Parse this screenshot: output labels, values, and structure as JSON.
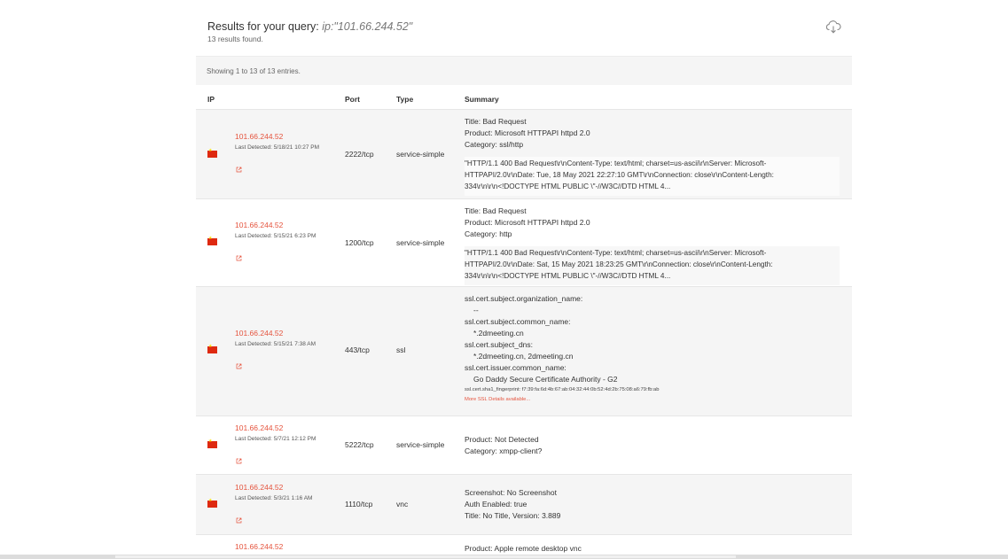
{
  "header": {
    "title_prefix": "Results for your query: ",
    "query": "ip:\"101.66.244.52\"",
    "results_found": "13 results found."
  },
  "showing": "Showing 1 to 13 of 13 entries.",
  "columns": {
    "ip": "IP",
    "port": "Port",
    "type": "Type",
    "summary": "Summary"
  },
  "icons": {
    "download": "cloud-download-icon",
    "flag": "china-flag-icon",
    "external": "external-link-icon"
  },
  "accent_color": "#e5533d",
  "rows": [
    {
      "ip": "101.66.244.52",
      "detected": "Last Detected: 5/18/21 10:27 PM",
      "port": "2222/tcp",
      "type": "service-simple",
      "summary": [
        "Title: Bad Request",
        "Product: Microsoft HTTPAPI httpd 2.0",
        "Category: ssl/http"
      ],
      "banner": "\"HTTP/1.1 400 Bad Request\\r\\nContent-Type: text/html; charset=us-ascii\\r\\nServer: Microsoft-HTTPAPI/2.0\\r\\nDate: Tue, 18 May 2021 22:27:10 GMT\\r\\nConnection: close\\r\\nContent-Length: 334\\r\\n\\r\\n<!DOCTYPE HTML PUBLIC \\\"-//W3C//DTD HTML 4..."
    },
    {
      "ip": "101.66.244.52",
      "detected": "Last Detected: 5/15/21 6:23 PM",
      "port": "1200/tcp",
      "type": "service-simple",
      "summary": [
        "Title: Bad Request",
        "Product: Microsoft HTTPAPI httpd 2.0",
        "Category: http"
      ],
      "banner": "\"HTTP/1.1 400 Bad Request\\r\\nContent-Type: text/html; charset=us-ascii\\r\\nServer: Microsoft-HTTPAPI/2.0\\r\\nDate: Sat, 15 May 2021 18:23:25 GMT\\r\\nConnection: close\\r\\nContent-Length: 334\\r\\n\\r\\n<!DOCTYPE HTML PUBLIC \\\"-//W3C//DTD HTML 4..."
    },
    {
      "ip": "101.66.244.52",
      "detected": "Last Detected: 5/15/21 7:38 AM",
      "port": "443/tcp",
      "type": "ssl",
      "ssl": {
        "org_label": "ssl.cert.subject.organization_name:",
        "org_value": "--",
        "cn_label": "ssl.cert.subject.common_name:",
        "cn_value": "*.2dmeeting.cn",
        "dns_label": "ssl.cert.subject_dns:",
        "dns_value": "*.2dmeeting.cn, 2dmeeting.cn",
        "issuer_label": "ssl.cert.issuer.common_name:",
        "issuer_value": "Go Daddy Secure Certificate Authority - G2",
        "fingerprint": "ssl.cert.sha1_fingerprint: f7:39:fa:6d:4b:67:ab:04:32:44:0b:52:4d:2b:75:08:a6:79:fb:ab",
        "more": "More SSL Details available..."
      }
    },
    {
      "ip": "101.66.244.52",
      "detected": "Last Detected: 5/7/21 12:12 PM",
      "port": "5222/tcp",
      "type": "service-simple",
      "summary": [
        "Product: Not Detected",
        "Category: xmpp-client?"
      ]
    },
    {
      "ip": "101.66.244.52",
      "detected": "Last Detected: 5/3/21 1:16 AM",
      "port": "1110/tcp",
      "type": "vnc",
      "summary": [
        "Screenshot: No Screenshot",
        "Auth Enabled: true",
        "Title: No Title, Version: 3.889"
      ]
    },
    {
      "ip": "101.66.244.52",
      "summary": [
        "Product: Apple remote desktop vnc"
      ]
    }
  ]
}
